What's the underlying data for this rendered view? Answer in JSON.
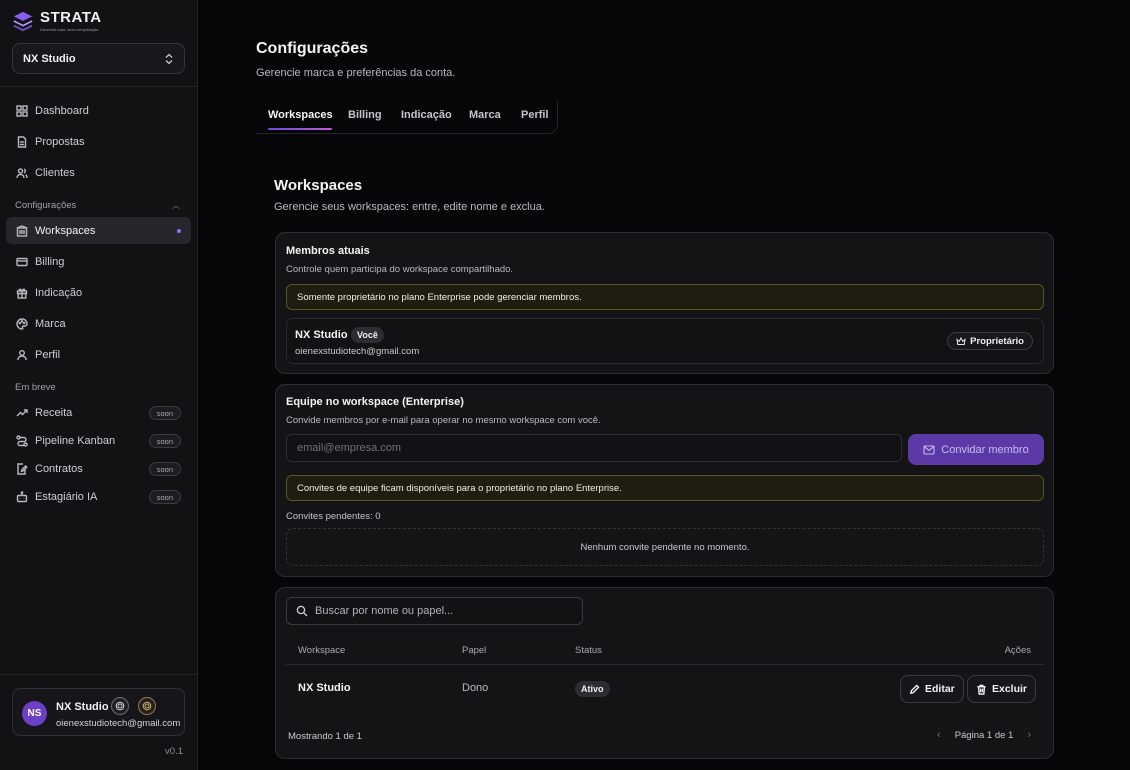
{
  "brand": {
    "name": "STRATA",
    "tagline": "Gerencie tudo, sem complicação."
  },
  "workspace_selector": {
    "value": "NX Studio"
  },
  "sidebar": {
    "main_items": [
      {
        "label": "Dashboard",
        "icon": "grid-icon"
      },
      {
        "label": "Propostas",
        "icon": "document-icon"
      },
      {
        "label": "Clientes",
        "icon": "users-icon"
      }
    ],
    "settings_section": "Configurações",
    "settings_items": [
      {
        "label": "Workspaces",
        "icon": "building-icon",
        "active": true
      },
      {
        "label": "Billing",
        "icon": "card-icon"
      },
      {
        "label": "Indicação",
        "icon": "gift-icon"
      },
      {
        "label": "Marca",
        "icon": "palette-icon"
      },
      {
        "label": "Perfil",
        "icon": "user-icon"
      }
    ],
    "soon_section": "Em breve",
    "soon_items": [
      {
        "label": "Receita",
        "icon": "trend-icon",
        "badge": "soon"
      },
      {
        "label": "Pipeline Kanban",
        "icon": "route-icon",
        "badge": "soon"
      },
      {
        "label": "Contratos",
        "icon": "contract-icon",
        "badge": "soon"
      },
      {
        "label": "Estagiário IA",
        "icon": "bot-icon",
        "badge": "soon"
      }
    ],
    "user": {
      "initials": "NS",
      "name": "NX Studio",
      "email": "oienexstudiotech@gmail.com"
    },
    "version": "v0.1"
  },
  "page": {
    "title": "Configurações",
    "subtitle": "Gerencie marca e preferências da conta.",
    "tabs": [
      "Workspaces",
      "Billing",
      "Indicação",
      "Marca",
      "Perfil"
    ],
    "active_tab": "Workspaces"
  },
  "workspaces": {
    "title": "Workspaces",
    "subtitle": "Gerencie seus workspaces: entre, edite nome e exclua."
  },
  "members": {
    "title": "Membros atuais",
    "subtitle": "Controle quem participa do workspace compartilhado.",
    "notice": "Somente proprietário no plano Enterprise pode gerenciar membros.",
    "member": {
      "name": "NX Studio",
      "you_badge": "Você",
      "email": "oienexstudiotech@gmail.com",
      "role": "Proprietário"
    }
  },
  "team": {
    "title": "Equipe no workspace (Enterprise)",
    "subtitle": "Convide membros por e-mail para operar no mesmo workspace com você.",
    "email_placeholder": "email@empresa.com",
    "invite_label": "Convidar membro",
    "notice": "Convites de equipe ficam disponíveis para o proprietário no plano Enterprise.",
    "pending_label": "Convites pendentes: 0",
    "empty_text": "Nenhum convite pendente no momento."
  },
  "table": {
    "search_placeholder": "Buscar por nome ou papel...",
    "headers": {
      "workspace": "Workspace",
      "role": "Papel",
      "status": "Status",
      "actions": "Ações"
    },
    "rows": [
      {
        "workspace": "NX Studio",
        "role": "Dono",
        "status": "Ativo"
      }
    ],
    "edit_label": "Editar",
    "delete_label": "Excluir",
    "showing": "Mostrando 1 de 1",
    "page_label": "Página 1 de 1"
  },
  "colors": {
    "accent": "#6b46c1",
    "background": "#060608",
    "sidebar": "#121215",
    "warning_border": "#5b5326"
  }
}
